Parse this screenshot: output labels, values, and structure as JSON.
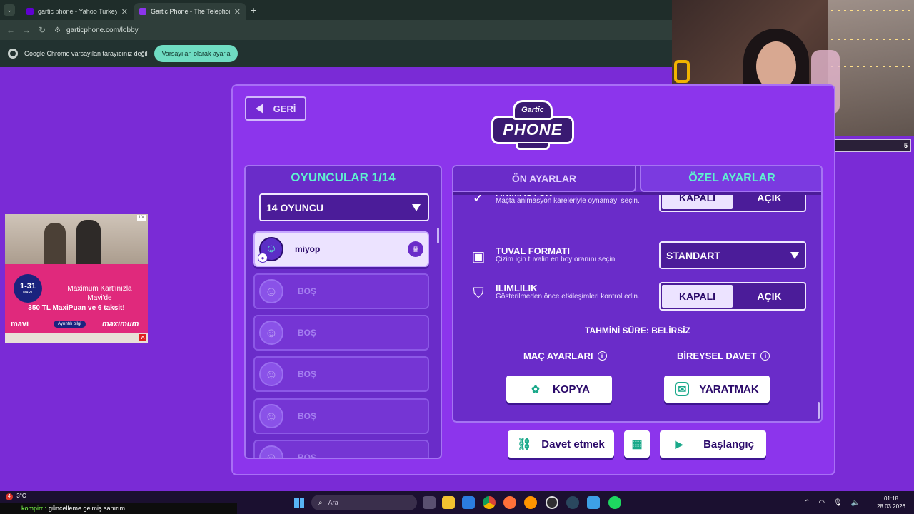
{
  "browser": {
    "tabs": [
      {
        "label": "gartic phone - Yahoo Turkey Ar",
        "active": false
      },
      {
        "label": "Gartic Phone - The Telephone G",
        "active": true
      }
    ],
    "url": "garticphone.com/lobby",
    "infobar_text": "Google Chrome varsayılan tarayıcınız değil",
    "infobar_button": "Varsayılan olarak ayarla"
  },
  "stream": {
    "sub_left": "1",
    "sub_label": "SUBSCRIBERS",
    "sub_right": "5",
    "sub_progress": 0.2
  },
  "ad": {
    "date_big": "1-31",
    "date_small": "MART",
    "line1": "Maximum Kart'ınızla Mavi'de",
    "line2": "350 TL MaxiPuan ve 6 taksit!",
    "brand_left": "mavi",
    "cta": "Ayrıntılı bilgi",
    "brand_right": "maximum",
    "choice": "i X",
    "badge": "A"
  },
  "game": {
    "back_label": "GERİ",
    "logo_top": "Gartic",
    "logo_main": "PHONE",
    "players": {
      "title": "OYUNCULAR 1/14",
      "count_select": "14 OYUNCU",
      "slots": [
        {
          "name": "miyop",
          "host": true
        },
        {
          "name": "BOŞ"
        },
        {
          "name": "BOŞ"
        },
        {
          "name": "BOŞ"
        },
        {
          "name": "BOŞ"
        },
        {
          "name": "BOŞ"
        }
      ]
    },
    "settings": {
      "tab_preset": "ÖN AYARLAR",
      "tab_custom": "ÖZEL AYARLAR",
      "animation": {
        "title": "ANİMASYON",
        "desc": "Maçta animasyon kareleriyle oynamayı seçin.",
        "off": "KAPALI",
        "on": "AÇIK"
      },
      "canvas": {
        "title": "TUVAL FORMATI",
        "desc": "Çizim için tuvalin en boy oranını seçin.",
        "value": "STANDART"
      },
      "moderation": {
        "title": "ILIMLILIK",
        "desc": "Gösterilmeden önce etkileşimleri kontrol edin.",
        "off": "KAPALI",
        "on": "AÇIK"
      },
      "estimate": "TAHMİNİ SÜRE: BELİRSİZ",
      "match_settings": "MAÇ AYARLARI",
      "personal_invite": "BİREYSEL DAVET",
      "copy_button": "KOPYA",
      "create_button": "YARATMAK"
    },
    "invite_button": "Davet etmek",
    "start_button": "Başlangıç"
  },
  "taskbar": {
    "weather_badge": "4",
    "weather": "3°C",
    "chat_user": "kompirr :",
    "chat_text": "güncelleme gelmiş sanırım",
    "search_placeholder": "Ara",
    "time": "01:18",
    "date": "28.03.2026"
  }
}
